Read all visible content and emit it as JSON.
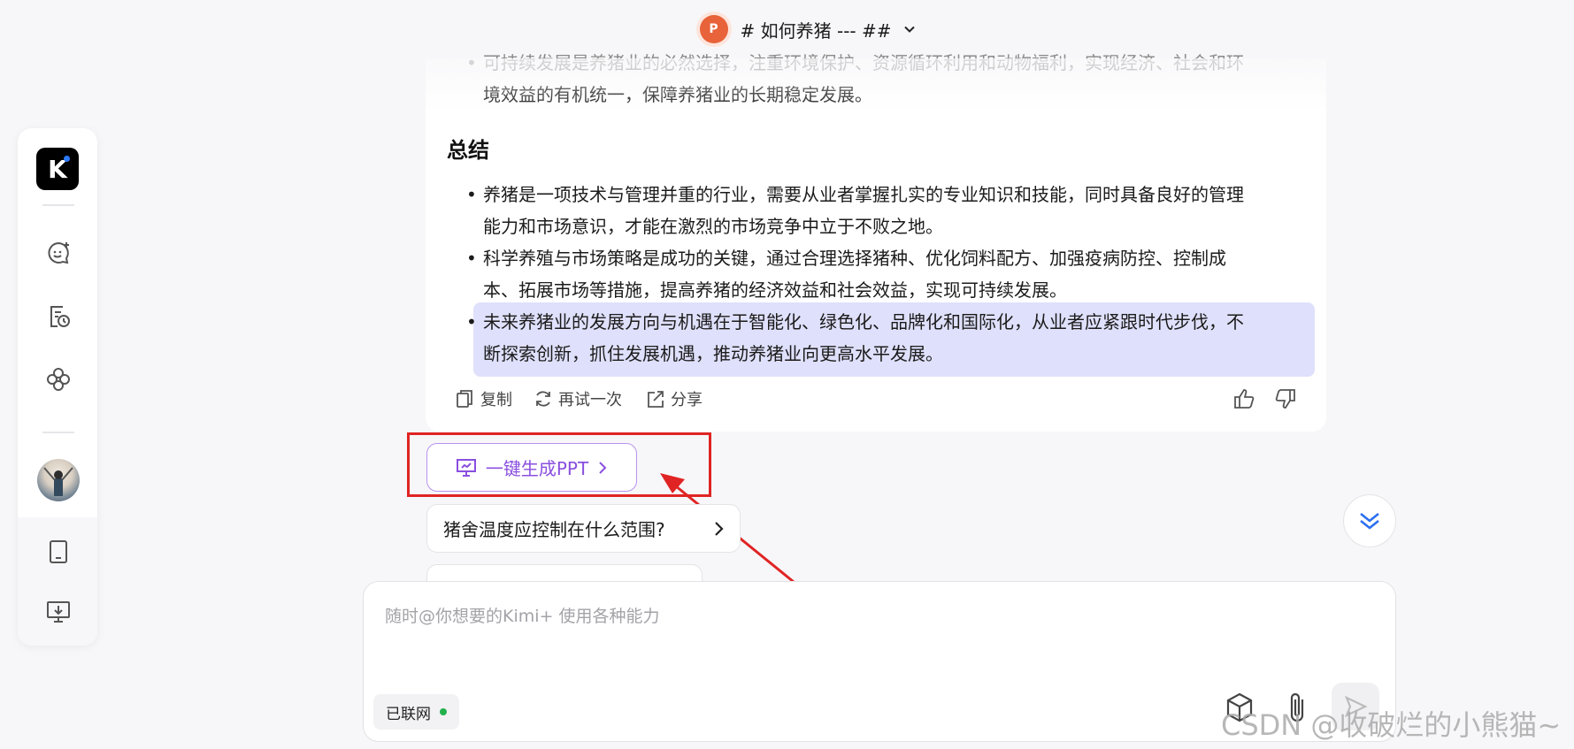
{
  "header": {
    "app_icon_letter": "P",
    "title": "# 如何养猪 --- ##"
  },
  "sidebar": {
    "logo_letter": "K",
    "items": [
      {
        "icon": "new-chat-icon"
      },
      {
        "icon": "history-icon"
      },
      {
        "icon": "kimi-plus-icon"
      },
      {
        "icon": "avatar"
      },
      {
        "icon": "tablet-icon"
      },
      {
        "icon": "desktop-download-icon"
      }
    ]
  },
  "message": {
    "faded_bullet": "可持续发展是养猪业的必然选择，注重环境保护、资源循环利用和动物福利，实现经济、社会和环境效益的有机统一，保障养猪业的长期稳定发展。",
    "faded_bullet_line1": "可持续发展是养猪业的必然选择，注重环境保护、资源循环利用和动物福利，实现经济、社会和环",
    "faded_bullet_line2": "境效益的有机统一，保障养猪业的长期稳定发展。",
    "heading": "总结",
    "bullets": [
      {
        "line1": "养猪是一项技术与管理并重的行业，需要从业者掌握扎实的专业知识和技能，同时具备良好的管理",
        "line2": "能力和市场意识，才能在激烈的市场竞争中立于不败之地。"
      },
      {
        "line1": "科学养殖与市场策略是成功的关键，通过合理选择猪种、优化饲料配方、加强疫病防控、控制成",
        "line2": "本、拓展市场等措施，提高养猪的经济效益和社会效益，实现可持续发展。"
      },
      {
        "line1": "未来养猪业的发展方向与机遇在于智能化、绿色化、品牌化和国际化，从业者应紧跟时代步伐，不",
        "line2": "断探索创新，抓住发展机遇，推动养猪业向更高水平发展。"
      }
    ],
    "actions": {
      "copy": "复制",
      "retry": "再试一次",
      "share": "分享"
    }
  },
  "ppt_button": {
    "label": "一键生成PPT"
  },
  "suggestions": [
    {
      "label": "猪舍温度应控制在什么范围?"
    }
  ],
  "input": {
    "placeholder": "随时@你想要的Kimi+ 使用各种能力",
    "network_label": "已联网"
  },
  "colors": {
    "accent_purple": "#8a4fe0",
    "highlight": "#dfe0fb",
    "annotation_red": "#e02424",
    "online_green": "#22b14c"
  },
  "watermark": "CSDN @收破烂的小熊猫~"
}
